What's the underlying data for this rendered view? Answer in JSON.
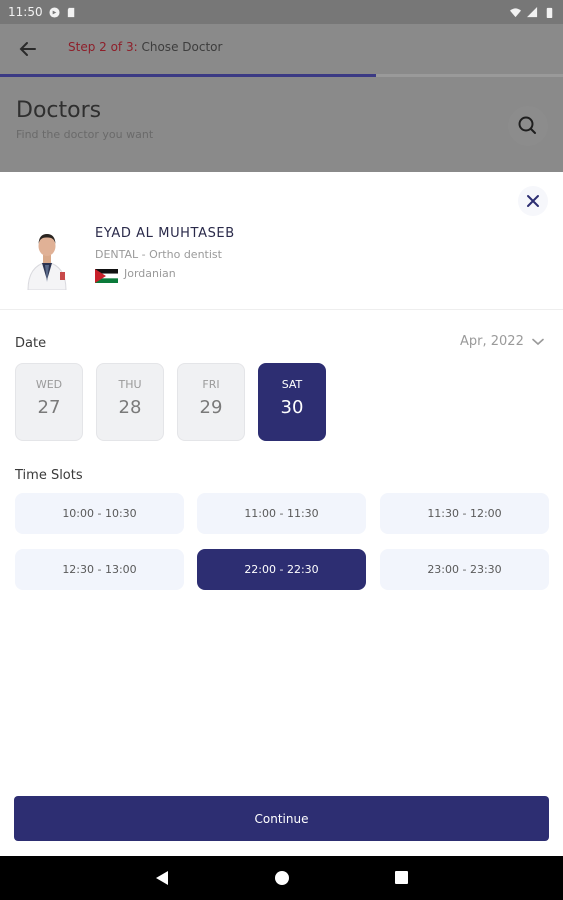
{
  "status_bar": {
    "time": "11:50"
  },
  "header": {
    "step_prefix": "Step 2 of 3:",
    "step_title": "Chose Doctor",
    "progress": 0.667,
    "page_title": "Doctors",
    "page_subtitle": "Find the doctor you want"
  },
  "doctor": {
    "name": "EYAD AL MUHTASEB",
    "specialty": "DENTAL - Ortho dentist",
    "nationality": "Jordanian"
  },
  "date_section": {
    "label": "Date",
    "month": "Apr, 2022",
    "days": [
      {
        "name": "WED",
        "num": "27"
      },
      {
        "name": "THU",
        "num": "28"
      },
      {
        "name": "FRI",
        "num": "29"
      },
      {
        "name": "SAT",
        "num": "30"
      }
    ],
    "selected_index": 3
  },
  "time_section": {
    "label": "Time Slots",
    "slots": [
      "10:00 - 10:30",
      "11:00 - 11:30",
      "11:30 - 12:00",
      "12:30 - 13:00",
      "22:00 - 22:30",
      "23:00 - 23:30"
    ],
    "selected_index": 4
  },
  "continue_label": "Continue",
  "colors": {
    "primary": "#2d2e72",
    "accent_red": "#8e1f2a",
    "slot_bg": "#f2f5fc"
  }
}
